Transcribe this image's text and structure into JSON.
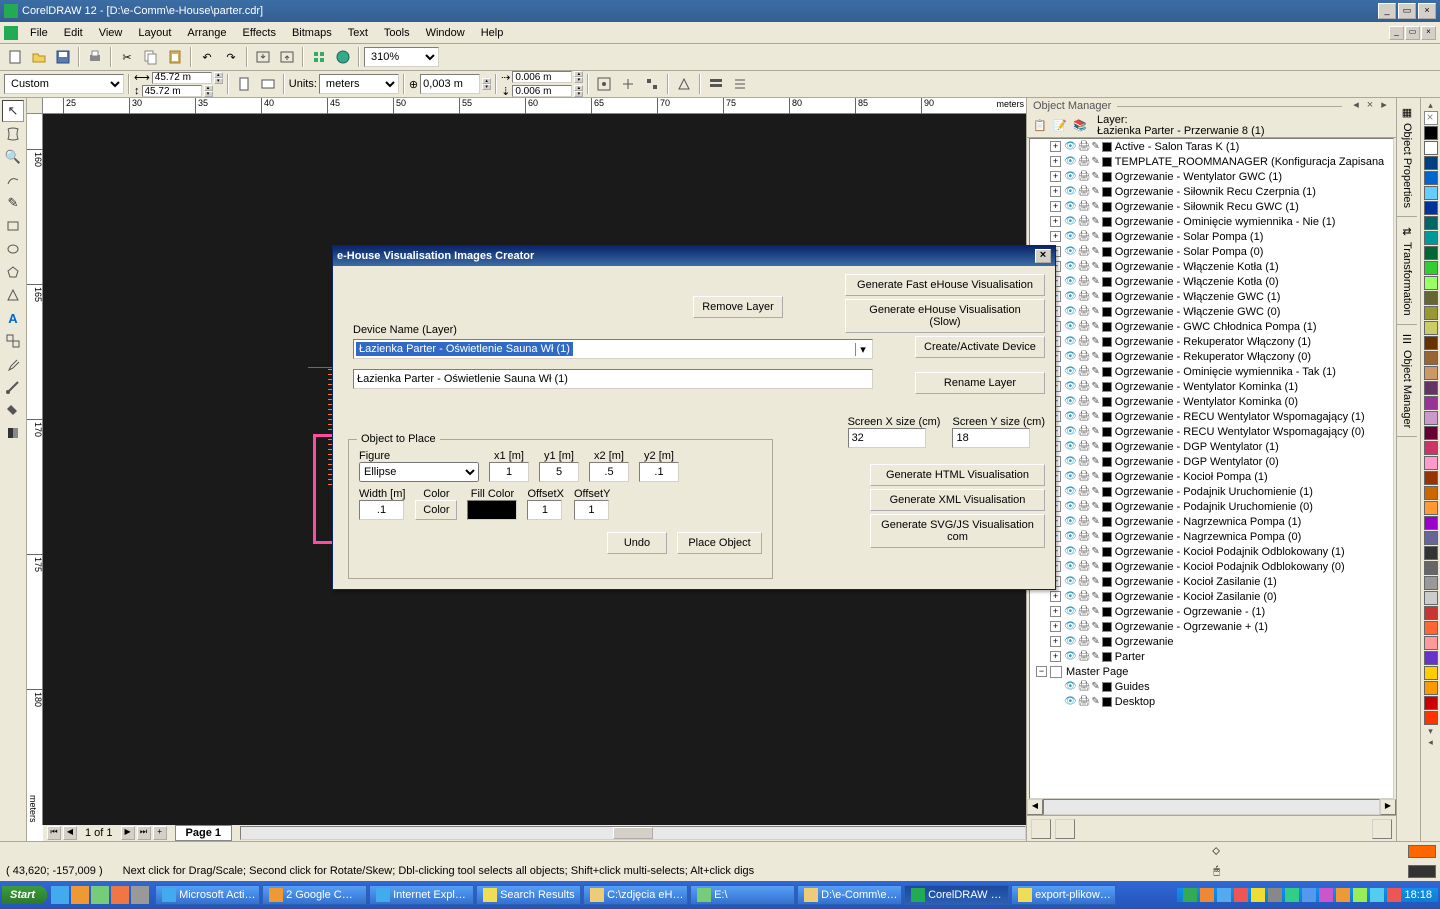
{
  "window": {
    "title": "CorelDRAW 12 - [D:\\e-Comm\\e-House\\parter.cdr]"
  },
  "menu": [
    "File",
    "Edit",
    "View",
    "Layout",
    "Arrange",
    "Effects",
    "Bitmaps",
    "Text",
    "Tools",
    "Window",
    "Help"
  ],
  "toolbar1": {
    "zoom": "310%"
  },
  "toolbar2": {
    "paper": "Custom",
    "w": "45.72 m",
    "h": "45.72 m",
    "units_label": "Units:",
    "units": "meters",
    "nudge": "0,003 m",
    "dupx": "0.006 m",
    "dupy": "0.006 m"
  },
  "ruler": {
    "h": [
      "25",
      "30",
      "35",
      "40",
      "45",
      "50",
      "55",
      "60",
      "65",
      "70",
      "75",
      "80",
      "85",
      "90"
    ],
    "v": [
      "160",
      "165",
      "170",
      "175",
      "180"
    ],
    "unit": "meters"
  },
  "pager": {
    "pos": "1 of 1",
    "tab": "Page 1"
  },
  "docker": {
    "title": "Object Manager",
    "layer_label": "Layer:",
    "current_layer": "Łazienka Parter - Przerwanie 8 (1)",
    "layers": [
      "Active - Salon Taras K (1)",
      "TEMPLATE_ROOMMANAGER (Konfiguracja Zapisana",
      "Ogrzewanie - Wentylator GWC (1)",
      "Ogrzewanie - Siłownik Recu Czerpnia (1)",
      "Ogrzewanie - Siłownik Recu GWC (1)",
      "Ogrzewanie - Ominięcie wymiennika - Nie (1)",
      "Ogrzewanie - Solar Pompa (1)",
      "Ogrzewanie - Solar Pompa (0)",
      "Ogrzewanie - Włączenie Kotła (1)",
      "Ogrzewanie - Włączenie Kotła (0)",
      "Ogrzewanie - Włączenie GWC (1)",
      "Ogrzewanie - Włączenie GWC (0)",
      "Ogrzewanie - GWC Chłodnica Pompa (1)",
      "Ogrzewanie - Rekuperator Włączony (1)",
      "Ogrzewanie - Rekuperator Włączony (0)",
      "Ogrzewanie - Ominięcie wymiennika - Tak (1)",
      "Ogrzewanie - Wentylator Kominka (1)",
      "Ogrzewanie - Wentylator Kominka (0)",
      "Ogrzewanie - RECU Wentylator Wspomagający (1)",
      "Ogrzewanie - RECU Wentylator Wspomagający (0)",
      "Ogrzewanie - DGP Wentylator (1)",
      "Ogrzewanie - DGP Wentylator (0)",
      "Ogrzewanie - Kocioł Pompa (1)",
      "Ogrzewanie - Podajnik Uruchomienie (1)",
      "Ogrzewanie - Podajnik Uruchomienie (0)",
      "Ogrzewanie - Nagrzewnica Pompa (1)",
      "Ogrzewanie - Nagrzewnica Pompa (0)",
      "Ogrzewanie - Kocioł Podajnik Odblokowany (1)",
      "Ogrzewanie - Kocioł Podajnik Odblokowany (0)",
      "Ogrzewanie - Kocioł Zasilanie (1)",
      "Ogrzewanie - Kocioł Zasilanie (0)",
      "Ogrzewanie - Ogrzewanie - (1)",
      "Ogrzewanie - Ogrzewanie + (1)",
      "Ogrzewanie",
      "Parter"
    ],
    "master": "Master Page",
    "guides": "Guides",
    "desktop": "Desktop"
  },
  "side_tabs": [
    "Object Properties",
    "Transformation",
    "Object Manager"
  ],
  "palette": [
    "#000000",
    "#ffffff",
    "#004080",
    "#0066cc",
    "#66ccff",
    "#003399",
    "#006666",
    "#009999",
    "#006633",
    "#33cc33",
    "#99ff66",
    "#666633",
    "#999933",
    "#cccc66",
    "#663300",
    "#996633",
    "#cc9966",
    "#663366",
    "#993399",
    "#cc99cc",
    "#660033",
    "#cc3366",
    "#ff99cc",
    "#993300",
    "#cc6600",
    "#ff9933",
    "#9900cc",
    "#666699",
    "#333333",
    "#666666",
    "#999999",
    "#cccccc",
    "#cc3333",
    "#ff6633",
    "#ff9999",
    "#6633cc",
    "#ffcc00",
    "#ff9900",
    "#cc0000",
    "#ff3300"
  ],
  "dialog": {
    "title": "e-House Visualisation Images Creator",
    "remove_layer": "Remove Layer",
    "gen_fast": "Generate Fast eHouse Visualisation",
    "gen_slow": "Generate eHouse Visualisation (Slow)",
    "device_name_label": "Device Name (Layer)",
    "device_name_value": "Łazienka Parter - Oświetlenie Sauna Wł (1)",
    "textbox_value": "Łazienka Parter - Oświetlenie Sauna Wł (1)",
    "create_activate": "Create/Activate Device",
    "rename_layer": "Rename Layer",
    "screen_x_label": "Screen X size (cm)",
    "screen_y_label": "Screen Y size (cm)",
    "screen_x": "32",
    "screen_y": "18",
    "gen_html": "Generate HTML Visualisation",
    "gen_xml": "Generate XML Visualisation",
    "gen_svg": "Generate SVG/JS Visualisation com",
    "fieldset_title": "Object to Place",
    "figure_label": "Figure",
    "figure": "Ellipse",
    "x1l": "x1 [m]",
    "y1l": "y1 [m]",
    "x2l": "x2 [m]",
    "y2l": "y2 [m]",
    "x1": "1",
    "y1": "5",
    "x2": ".5",
    "y2": ".1",
    "widthl": "Width [m]",
    "colorl": "Color",
    "fillcl": "Fill Color",
    "ofxl": "OffsetX",
    "ofyl": "OffsetY",
    "width": ".1",
    "color_btn": "Color",
    "ofx": "1",
    "ofy": "1",
    "undo": "Undo",
    "place": "Place Object"
  },
  "status": {
    "coords": "( 43,620; -157,009 )",
    "hint": "Next click for Drag/Scale; Second click for Rotate/Skew; Dbl-clicking tool selects all objects; Shift+click multi-selects; Alt+click digs",
    "fill": "#ff6600",
    "outline": "#333333"
  },
  "taskbar": {
    "start": "Start",
    "tasks": [
      "Microsoft Acti…",
      "2 Google C…",
      "Internet Expl…",
      "Search Results",
      "C:\\zdjęcia eH…",
      "E:\\",
      "D:\\e-Comm\\e…",
      "CorelDRAW …",
      "export-plikow…"
    ],
    "clock": "18:18"
  }
}
